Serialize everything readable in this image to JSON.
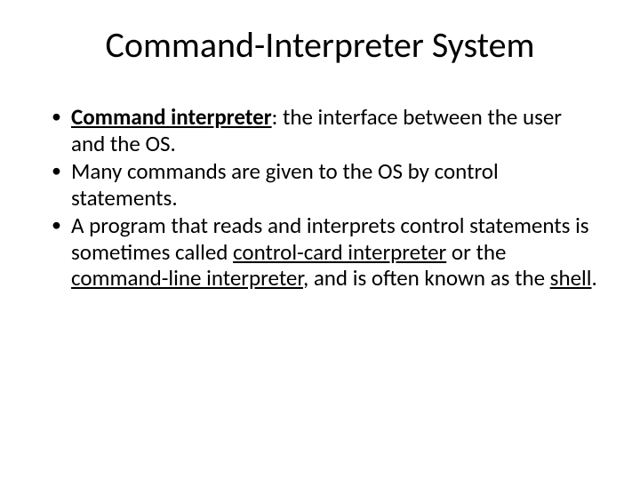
{
  "title": "Command-Interpreter System",
  "b1_lead": "Command interpreter",
  "b1_rest": ": the interface between the user and the OS.",
  "b2": "Many commands are given to the OS by control statements.",
  "b3_a": "A program that reads and interprets control statements is sometimes called ",
  "b3_term1": "control-card interpreter",
  "b3_b": " or the ",
  "b3_term2": "command-line interpreter",
  "b3_c": ", and is often known as the ",
  "b3_term3": "shell",
  "b3_d": "."
}
